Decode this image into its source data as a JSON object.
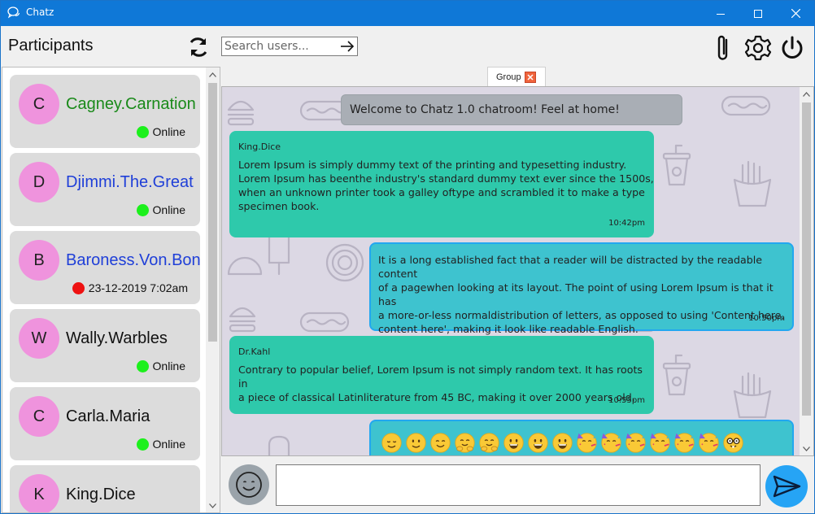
{
  "window": {
    "title": "Chatz",
    "controls": [
      "minimize-icon",
      "maximize-icon",
      "close-icon"
    ]
  },
  "sidebar": {
    "title": "Participants",
    "refresh_icon": "refresh-icon"
  },
  "search": {
    "placeholder": "Search users...",
    "go_icon": "arrow-right-icon"
  },
  "toolbar": {
    "attach_icon": "paperclip-icon",
    "settings_icon": "gear-icon",
    "power_icon": "power-icon"
  },
  "users": [
    {
      "initial": "C",
      "name": "Cagney.Carnation",
      "name_color": "#1a8a1a",
      "status": "Online",
      "status_color": "#1cf01c"
    },
    {
      "initial": "D",
      "name": "Djimmi.The.Great",
      "name_color": "#1f3fd8",
      "status": "Online",
      "status_color": "#1cf01c"
    },
    {
      "initial": "B",
      "name": "Baroness.Von.Bon",
      "name_color": "#1f3fd8",
      "status": "23-12-2019 7:02am",
      "status_color": "#ee1111"
    },
    {
      "initial": "W",
      "name": "Wally.Warbles",
      "name_color": "#111111",
      "status": "Online",
      "status_color": "#1cf01c"
    },
    {
      "initial": "C",
      "name": "Carla.Maria",
      "name_color": "#111111",
      "status": "Online",
      "status_color": "#1cf01c"
    },
    {
      "initial": "K",
      "name": "King.Dice",
      "name_color": "#111111",
      "status": "",
      "status_color": ""
    }
  ],
  "tabs": [
    {
      "label": "Group",
      "close_icon": "close-icon"
    }
  ],
  "chat": {
    "welcome": "Welcome to Chatz 1.0 chatroom! Feel at home!",
    "messages": [
      {
        "sender": "King.Dice",
        "text": "Lorem Ipsum is simply dummy text of the printing and typesetting industry.\nLorem Ipsum has beenthe industry's standard dummy text ever since the 1500s,\nwhen an unknown printer took a galley oftype and scrambled it to make a type\nspecimen book.",
        "time": "10:42pm",
        "direction": "in"
      },
      {
        "sender": "",
        "text": "It is a long established fact that a reader will be distracted by the readable content\nof a pagewhen looking at its layout. The point of using Lorem Ipsum is that it has\na more-or-less normaldistribution of letters, as opposed to using 'Content here,\ncontent here', making it look like readable English.",
        "time": "10:50pm",
        "direction": "out"
      },
      {
        "sender": "Dr.Kahl",
        "text": "Contrary to popular belief, Lorem Ipsum is not simply random text. It has roots in\na piece of classical Latinliterature from 45 BC, making it over 2000 years old.",
        "time": "10:55pm",
        "direction": "in"
      }
    ],
    "emoji_message": {
      "direction": "out",
      "emojis": [
        "relieved-face-icon",
        "slightly-smiling-face-icon",
        "smiling-face-icon",
        "hugging-face-icon",
        "hugging-face-icon",
        "grinning-face-icon",
        "grinning-face-icon",
        "grinning-face-icon",
        "partying-face-icon",
        "partying-face-icon",
        "partying-face-icon",
        "partying-face-icon",
        "partying-face-icon",
        "partying-face-icon",
        "nerd-face-icon"
      ]
    }
  },
  "composer": {
    "emoji_button_icon": "smiley-icon",
    "input_value": "",
    "send_icon": "send-icon"
  },
  "colors": {
    "titlebar": "#0f78d7",
    "incoming_bubble": "#2ec9ab",
    "outgoing_bubble": "#3ec3cf",
    "outgoing_border": "#22a7f0",
    "avatar": "#ef93dd",
    "chat_background": "#dcd8e4",
    "send_button": "#26a4f5"
  }
}
